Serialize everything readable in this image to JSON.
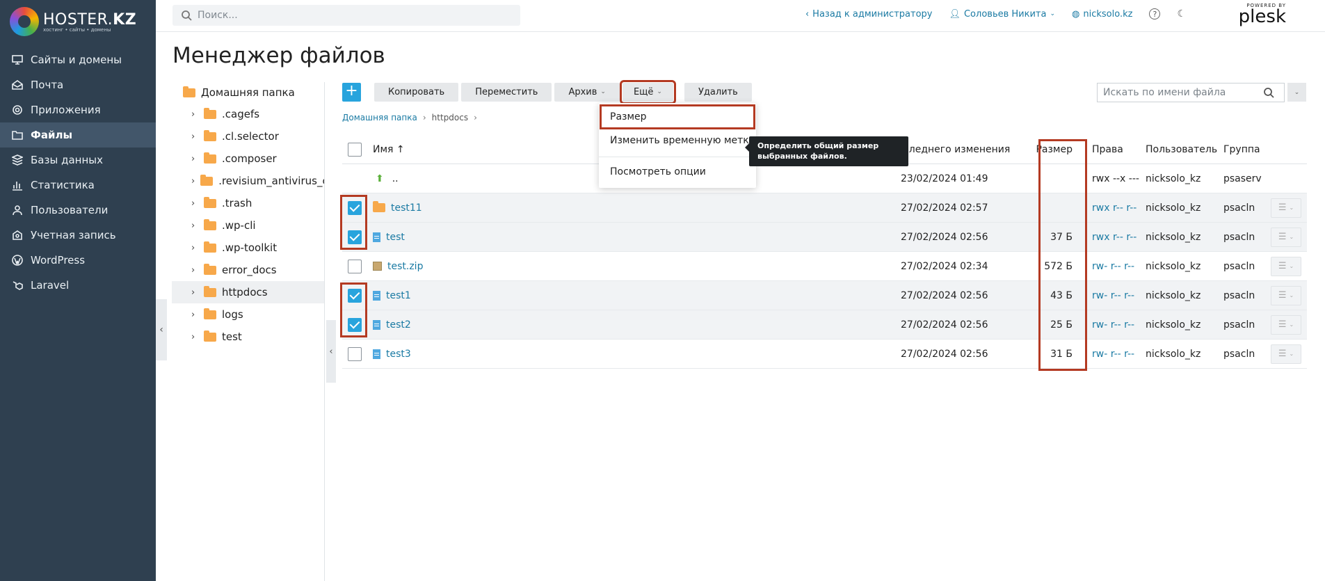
{
  "brand": {
    "name_light": "HOSTER.",
    "name_bold": "KZ",
    "tagline": "хостинг • сайты • домены"
  },
  "sidebar": {
    "items": [
      {
        "label": "Сайты и домены",
        "icon": "monitor-icon"
      },
      {
        "label": "Почта",
        "icon": "mail-icon"
      },
      {
        "label": "Приложения",
        "icon": "gear-icon"
      },
      {
        "label": "Файлы",
        "icon": "folder-icon",
        "active": true
      },
      {
        "label": "Базы данных",
        "icon": "database-icon"
      },
      {
        "label": "Статистика",
        "icon": "chart-icon"
      },
      {
        "label": "Пользователи",
        "icon": "user-icon"
      },
      {
        "label": "Учетная запись",
        "icon": "account-icon"
      },
      {
        "label": "WordPress",
        "icon": "wordpress-icon"
      },
      {
        "label": "Laravel",
        "icon": "laravel-icon"
      }
    ]
  },
  "header": {
    "search_placeholder": "Поиск...",
    "back_link": "Назад к администратору",
    "user": "Соловьев Никита",
    "domain": "nicksolo.kz",
    "plesk_small": "POWERED BY",
    "plesk_big": "plesk"
  },
  "page": {
    "title": "Менеджер файлов"
  },
  "tree": {
    "root": "Домашняя папка",
    "items": [
      ".cagefs",
      ".cl.selector",
      ".composer",
      ".revisium_antivirus_cache",
      ".trash",
      ".wp-cli",
      ".wp-toolkit",
      "error_docs",
      "httpdocs",
      "logs",
      "test"
    ],
    "selected_index": 8
  },
  "toolbar": {
    "add": "+",
    "copy": "Копировать",
    "move": "Переместить",
    "archive": "Архив",
    "more": "Ещё",
    "delete": "Удалить",
    "file_search_placeholder": "Искать по имени файла"
  },
  "breadcrumbs": {
    "root": "Домашняя папка",
    "current": "httpdocs"
  },
  "table": {
    "headers": {
      "name": "Имя ↑",
      "date": "Последнего изменения",
      "size": "Размер",
      "perms": "Права",
      "user": "Пользователь",
      "group": "Группа"
    },
    "rows": [
      {
        "type": "up",
        "name": "..",
        "date": "23/02/2024 01:49",
        "size": "",
        "perms": "rwx --x ---",
        "user": "nicksolo_kz",
        "group": "psaserv",
        "checked": false
      },
      {
        "type": "folder",
        "name": "test11",
        "date": "27/02/2024 02:57",
        "size": "",
        "perms": "rwx r-- r--",
        "user": "nicksolo_kz",
        "group": "psacln",
        "checked": true
      },
      {
        "type": "file",
        "name": "test",
        "date": "27/02/2024 02:56",
        "size": "37 Б",
        "perms": "rwx r-- r--",
        "user": "nicksolo_kz",
        "group": "psacln",
        "checked": true
      },
      {
        "type": "zip",
        "name": "test.zip",
        "date": "27/02/2024 02:34",
        "size": "572 Б",
        "perms": "rw- r-- r--",
        "user": "nicksolo_kz",
        "group": "psacln",
        "checked": false
      },
      {
        "type": "file",
        "name": "test1",
        "date": "27/02/2024 02:56",
        "size": "43 Б",
        "perms": "rw- r-- r--",
        "user": "nicksolo_kz",
        "group": "psacln",
        "checked": true
      },
      {
        "type": "file",
        "name": "test2",
        "date": "27/02/2024 02:56",
        "size": "25 Б",
        "perms": "rw- r-- r--",
        "user": "nicksolo_kz",
        "group": "psacln",
        "checked": true
      },
      {
        "type": "file",
        "name": "test3",
        "date": "27/02/2024 02:56",
        "size": "31 Б",
        "perms": "rw- r-- r--",
        "user": "nicksolo_kz",
        "group": "psacln",
        "checked": false
      }
    ]
  },
  "dropdown": {
    "items": [
      "Размер",
      "Изменить временную метку",
      "Посмотреть опции"
    ],
    "tooltip": "Определить общий размер выбранных файлов."
  },
  "colors": {
    "sidebar": "#2f4050",
    "accent": "#28a4dd",
    "link": "#1a7aa3",
    "highlight": "#b43a22"
  }
}
